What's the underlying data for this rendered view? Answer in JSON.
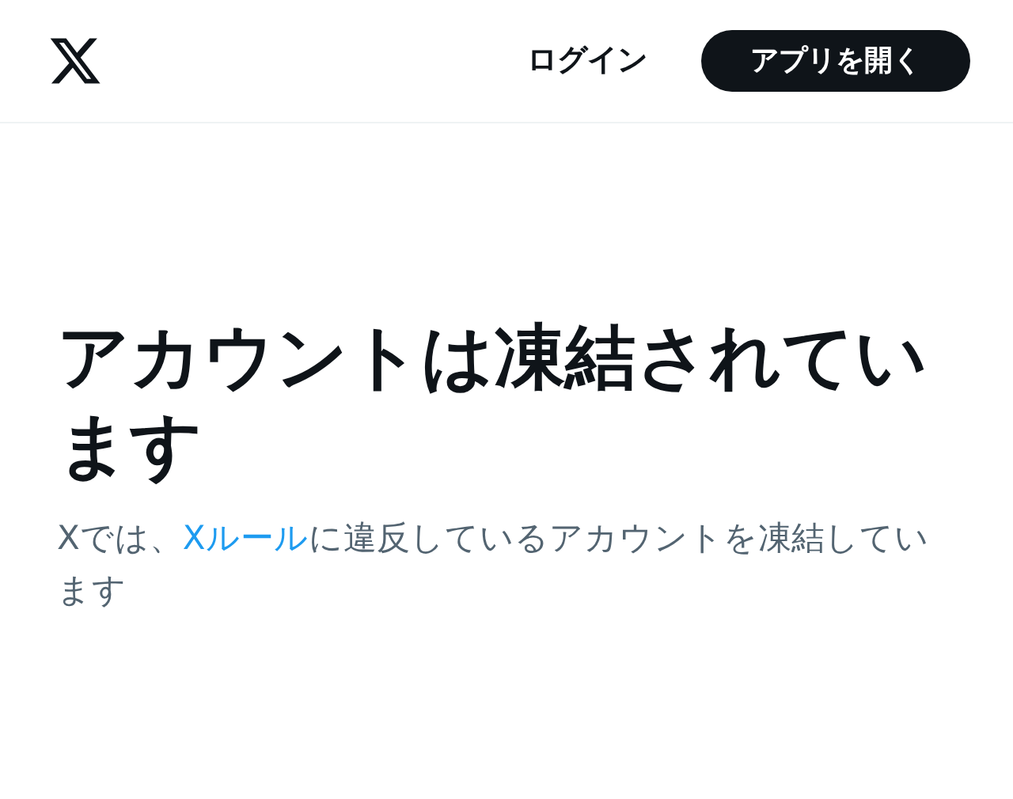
{
  "header": {
    "login": "ログイン",
    "open_app": "アプリを開く"
  },
  "heading": "アカウントは凍結されています",
  "message": {
    "before": "Xでは、",
    "link": "Xルール",
    "after": "に違反しているアカウントを凍結しています"
  }
}
